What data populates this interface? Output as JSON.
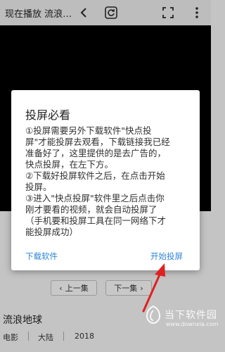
{
  "header": {
    "title": "现在播放 流浪…",
    "icons": [
      "back-icon",
      "refresh-icon",
      "fullscreen-icon",
      "more-icon"
    ]
  },
  "dialog": {
    "title": "投屏必看",
    "lines": [
      "①投屏需要另外下载软件\"快点投",
      "屏\"才能投屏去观看，下载链接我已经",
      "准备好了，这里提供的是去广告的，",
      "快点投屏，在左下方。",
      "②下载好投屏软件之后，在点击开始",
      "投屏。",
      "③进入\"快点投屏\"软件里之后点击你",
      "刚才要看的视频，就会自动投屏了",
      "（手机要和投屏工具在同一网络下才",
      "能投屏成功）"
    ],
    "download_label": "下载软件",
    "start_label": "开始投屏"
  },
  "episode_nav": {
    "prev_label": "上一集",
    "next_label": "下一集"
  },
  "show": {
    "title": "流浪地球",
    "genre": "电影",
    "region": "大陆",
    "year": "2018"
  },
  "watermark": {
    "name": "当下软件园",
    "url": "www.downxia.com"
  },
  "colors": {
    "dialog_button": "#2f86d6",
    "arrow": "#e02020",
    "overlay": "#c4c4c4"
  }
}
